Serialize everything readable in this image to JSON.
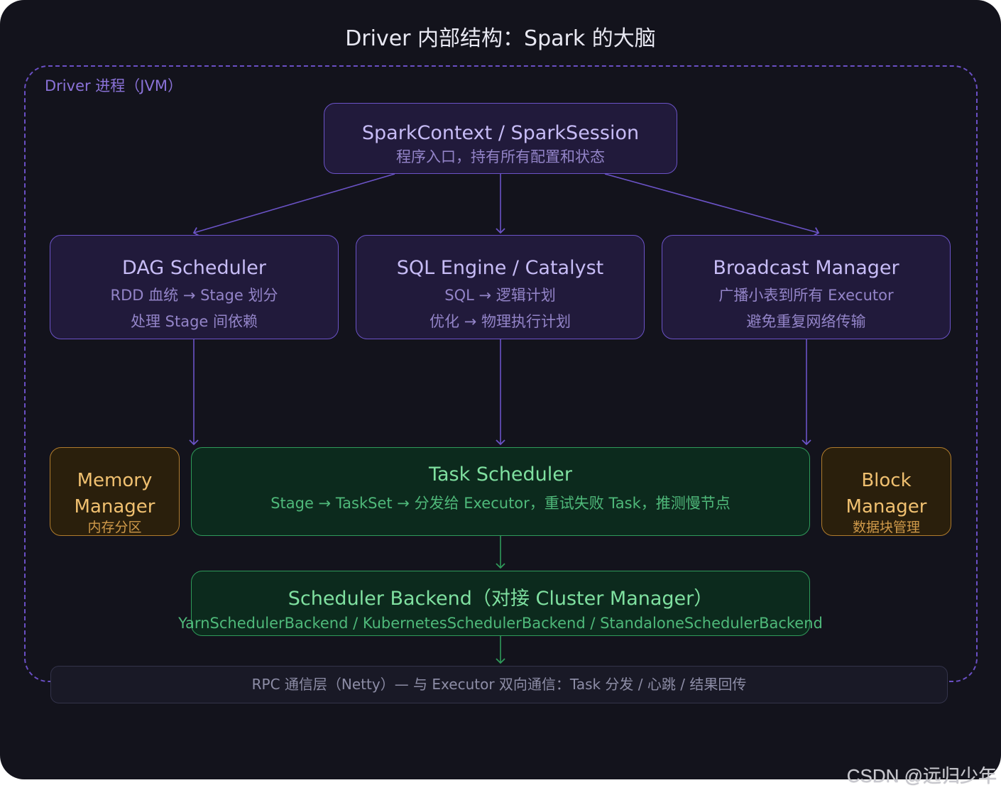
{
  "title": "Driver 内部结构：Spark 的大脑",
  "process": {
    "label": "Driver 进程（JVM）"
  },
  "nodes": {
    "spark_context": {
      "title": "SparkContext / SparkSession",
      "desc": "程序入口，持有所有配置和状态"
    },
    "dag_scheduler": {
      "title": "DAG Scheduler",
      "lines": [
        "RDD 血统 → Stage 划分",
        "处理 Stage 间依赖"
      ]
    },
    "sql_engine": {
      "title": "SQL Engine / Catalyst",
      "lines": [
        "SQL → 逻辑计划",
        "优化 → 物理执行计划"
      ]
    },
    "broadcast_manager": {
      "title": "Broadcast Manager",
      "lines": [
        "广播小表到所有 Executor",
        "避免重复网络传输"
      ]
    },
    "memory_manager": {
      "title_lines": [
        "Memory",
        "Manager"
      ],
      "desc": "内存分区"
    },
    "task_scheduler": {
      "title": "Task Scheduler",
      "desc": "Stage → TaskSet → 分发给 Executor，重试失败 Task，推测慢节点"
    },
    "block_manager": {
      "title_lines": [
        "Block",
        "Manager"
      ],
      "desc": "数据块管理"
    },
    "scheduler_backend": {
      "title": "Scheduler Backend（对接 Cluster Manager）",
      "desc": "YarnSchedulerBackend / KubernetesSchedulerBackend / StandaloneSchedulerBackend"
    }
  },
  "rpc_layer": {
    "label": "RPC 通信层（Netty）— 与 Executor 双向通信：Task 分发 / 心跳 / 结果回传"
  },
  "watermark": "CSDN @远归少年",
  "colors": {
    "background": "#13131c",
    "purple_border": "#6b53c7",
    "green_border": "#2f9a5a",
    "amber_border": "#b07c2c"
  }
}
